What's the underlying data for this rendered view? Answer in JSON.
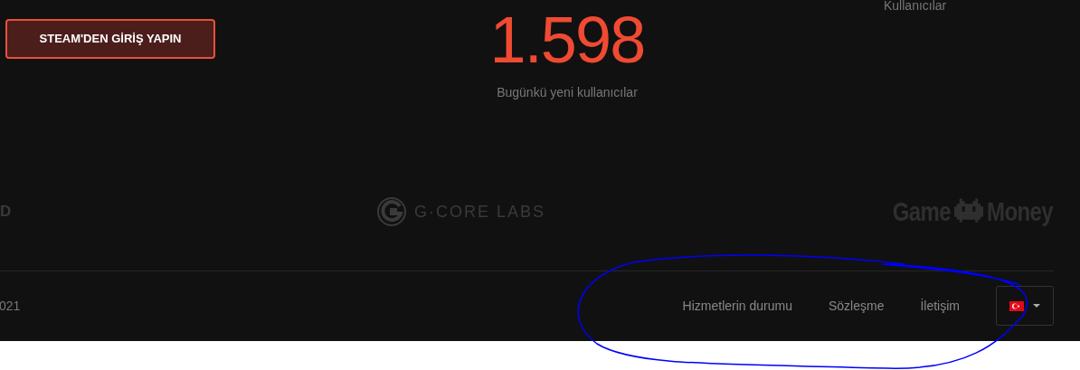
{
  "login_button": {
    "label": "STEAM'DEN GİRİŞ YAPIN"
  },
  "stat": {
    "value": "1.598",
    "label": "Bugünkü yeni kullanıcılar"
  },
  "stat_right": {
    "label": "Kullanıcılar"
  },
  "partners": [
    {
      "kind": "cut",
      "text": "D"
    },
    {
      "kind": "gcore",
      "text": "G·CORE LABS"
    },
    {
      "kind": "gamemoney",
      "words": [
        "Game",
        "Money"
      ]
    }
  ],
  "footer": {
    "copyright": "021",
    "links": [
      "Hizmetlerin durumu",
      "Sözleşme",
      "İletişim"
    ]
  }
}
